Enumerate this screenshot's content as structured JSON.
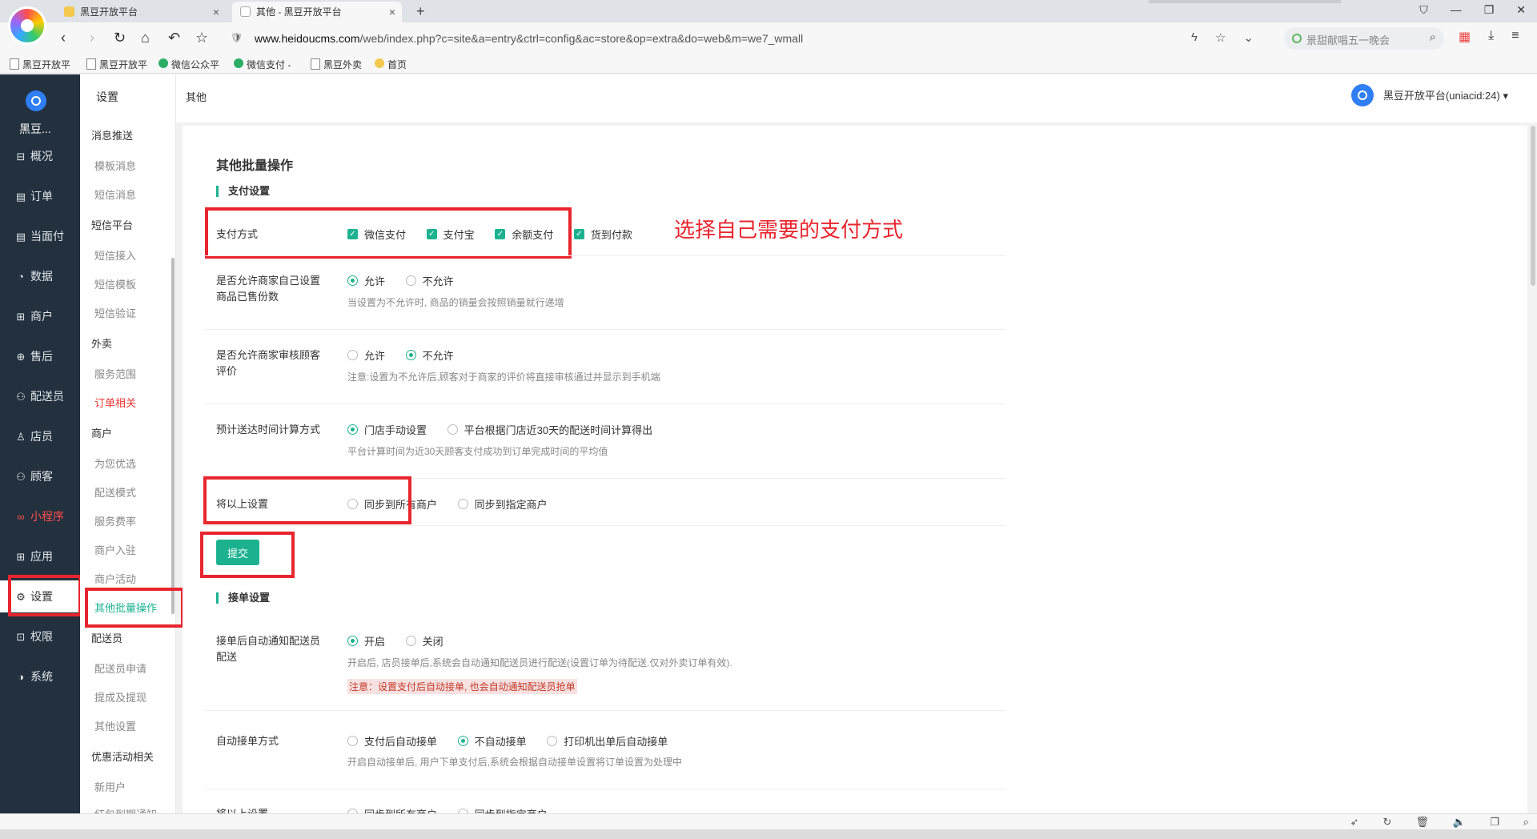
{
  "browser": {
    "tabs": [
      {
        "title": "黑豆开放平台"
      },
      {
        "title": "其他 - 黑豆开放平台"
      }
    ],
    "url_domain": "www.heidoucms.com",
    "url_path": "/web/index.php?c=site&a=entry&ctrl=config&ac=store&op=extra&do=web&m=we7_wmall",
    "search_placeholder": "景甜献唱五一晚会",
    "bookmarks": [
      "黑豆开放平",
      "黑豆开放平",
      "微信公众平",
      "微信支付 -",
      "黑豆外卖",
      "首页"
    ]
  },
  "sidebar": {
    "brand": "黑豆...",
    "items": [
      {
        "label": "概况",
        "icon": "dashboard-icon"
      },
      {
        "label": "订单",
        "icon": "order-icon"
      },
      {
        "label": "当面付",
        "icon": "pay-icon"
      },
      {
        "label": "数据",
        "icon": "data-icon"
      },
      {
        "label": "商户",
        "icon": "store-icon"
      },
      {
        "label": "售后",
        "icon": "aftersale-icon"
      },
      {
        "label": "配送员",
        "icon": "courier-icon"
      },
      {
        "label": "店员",
        "icon": "clerk-icon"
      },
      {
        "label": "顾客",
        "icon": "customer-icon"
      },
      {
        "label": "小程序",
        "icon": "miniapp-icon"
      },
      {
        "label": "应用",
        "icon": "apps-icon"
      },
      {
        "label": "设置",
        "icon": "gear-icon"
      },
      {
        "label": "权限",
        "icon": "lock-icon"
      },
      {
        "label": "系统",
        "icon": "system-icon"
      }
    ]
  },
  "subnav": {
    "head": "设置",
    "entries": [
      {
        "type": "group",
        "label": "消息推送"
      },
      {
        "type": "item",
        "label": "模板消息"
      },
      {
        "type": "item",
        "label": "短信消息"
      },
      {
        "type": "group",
        "label": "短信平台"
      },
      {
        "type": "item",
        "label": "短信接入"
      },
      {
        "type": "item",
        "label": "短信模板"
      },
      {
        "type": "item",
        "label": "短信验证"
      },
      {
        "type": "group",
        "label": "外卖"
      },
      {
        "type": "item",
        "label": "服务范围"
      },
      {
        "type": "item",
        "label": "订单相关"
      },
      {
        "type": "group",
        "label": "商户"
      },
      {
        "type": "item",
        "label": "为您优选"
      },
      {
        "type": "item",
        "label": "配送模式"
      },
      {
        "type": "item",
        "label": "服务费率"
      },
      {
        "type": "item",
        "label": "商户入驻"
      },
      {
        "type": "item",
        "label": "商户活动"
      },
      {
        "type": "item",
        "label": "其他批量操作"
      },
      {
        "type": "group",
        "label": "配送员"
      },
      {
        "type": "item",
        "label": "配送员申请"
      },
      {
        "type": "item",
        "label": "提成及提现"
      },
      {
        "type": "item",
        "label": "其他设置"
      },
      {
        "type": "group",
        "label": "优惠活动相关"
      },
      {
        "type": "item",
        "label": "新用户"
      },
      {
        "type": "item",
        "label": "红包到期通知"
      }
    ]
  },
  "topbar": {
    "breadcrumb": "其他",
    "account": "黑豆开放平台(uniacid:24)",
    "caret": "▾"
  },
  "main": {
    "title": "其他批量操作",
    "section_payment": "支付设置",
    "payment_label": "支付方式",
    "payment_options": [
      "微信支付",
      "支付宝",
      "余额支付",
      "货到付款"
    ],
    "annotation": "选择自己需要的支付方式",
    "sold_label": "是否允许商家自己设置商品已售份数",
    "sold_options": [
      "允许",
      "不允许"
    ],
    "sold_hint": "当设置为不允许时, 商品的销量会按照销量就行递增",
    "review_label": "是否允许商家审核顾客评价",
    "review_options": [
      "允许",
      "不允许"
    ],
    "review_hint": "注意:设置为不允许后,顾客对于商家的评价将直接审核通过并显示到手机端",
    "eta_label": "预计送达时间计算方式",
    "eta_options": [
      "门店手动设置",
      "平台根据门店近30天的配送时间计算得出"
    ],
    "eta_hint": "平台计算时间为近30天顾客支付成功到订单完成时间的平均值",
    "sync_label": "将以上设置",
    "sync_options": [
      "同步到所有商户",
      "同步到指定商户"
    ],
    "submit": "提交",
    "section_accept": "接单设置",
    "notify_label": "接单后自动通知配送员配送",
    "notify_options": [
      "开启",
      "关闭"
    ],
    "notify_hint": "开启后, 店员接单后,系统会自动通知配送员进行配送(设置订单为待配送.仅对外卖订单有效).",
    "notify_warn": "注意：设置支付后自动接单, 也会自动通知配送员抢单",
    "auto_label": "自动接单方式",
    "auto_options": [
      "支付后自动接单",
      "不自动接单",
      "打印机出单后自动接单"
    ],
    "auto_hint": "开启自动接单后, 用户下单支付后,系统会根据自动接单设置将订单设置为处理中",
    "sync2_label": "将以上设置",
    "sync2_options": [
      "同步到所有商户",
      "同步到指定商户"
    ]
  },
  "colors": {
    "accent": "#1cb290",
    "sidebar_bg": "#23313e",
    "annotation": "#e8252e"
  }
}
